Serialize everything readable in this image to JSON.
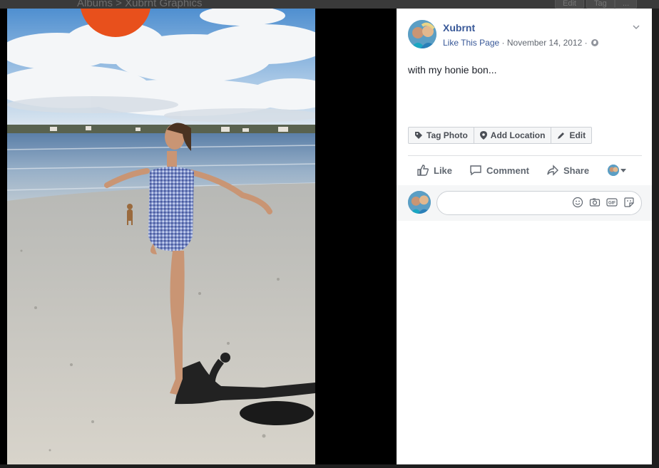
{
  "background": {
    "breadcrumb": "Albums > Xubrnt Graphics",
    "buttons": [
      "Edit",
      "Tag",
      "..."
    ]
  },
  "post": {
    "author": "Xubrnt",
    "like_page": "Like This Page",
    "separator": "·",
    "date": "November 14, 2012",
    "audience_icon": "globe-icon",
    "text": "with my honie bon..."
  },
  "photo_actions": [
    {
      "label": "Tag Photo",
      "icon": "tag-icon"
    },
    {
      "label": "Add Location",
      "icon": "location-pin-icon"
    },
    {
      "label": "Edit",
      "icon": "pencil-icon"
    }
  ],
  "reactions": {
    "like": "Like",
    "comment": "Comment",
    "share": "Share"
  },
  "comment_box": {
    "placeholder": ""
  },
  "colors": {
    "link": "#385898",
    "accent_orange": "#e8501c",
    "panel_bg": "#ffffff",
    "stage_bg": "#000000"
  }
}
